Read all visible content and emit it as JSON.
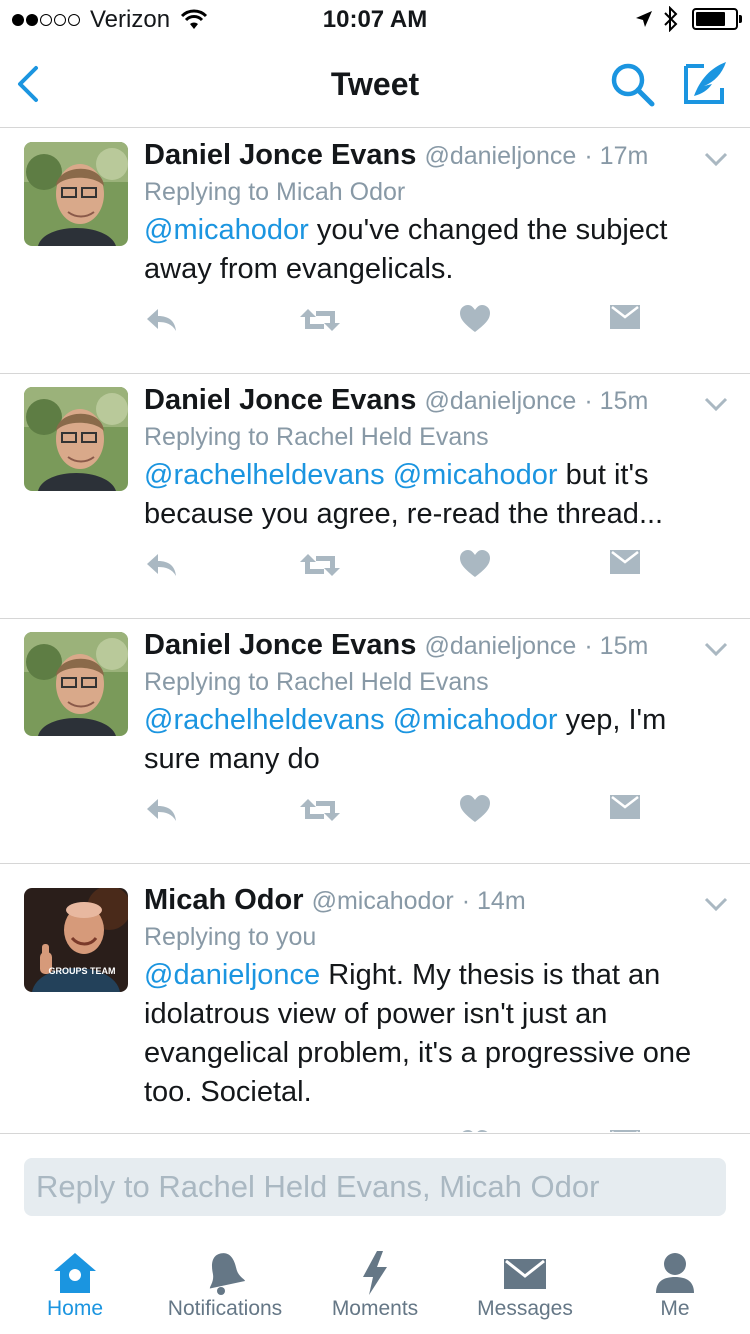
{
  "status_bar": {
    "carrier": "Verizon",
    "time": "10:07 AM",
    "signal_bars_filled": 2,
    "signal_bars_total": 5,
    "battery_level": 0.75
  },
  "nav": {
    "title": "Tweet",
    "back_icon": "chevron-left-icon",
    "search_icon": "search-icon",
    "compose_icon": "compose-icon"
  },
  "colors": {
    "accent": "#1b95e0",
    "secondary_text": "#8899a6",
    "action_icons": "#aab8c2"
  },
  "tweets": [
    {
      "name": "Daniel Jonce Evans",
      "handle": "@danieljonce",
      "time": "· 17m",
      "replying_to": "Replying to Micah Odor",
      "mentions": "@micahodor",
      "text": " you've changed the subject away from evangelicals."
    },
    {
      "name": "Daniel Jonce Evans",
      "handle": "@danieljonce",
      "time": "· 15m",
      "replying_to": "Replying to Rachel Held Evans",
      "mentions": "@rachelheldevans @micahodor",
      "text": " but it's because you agree, re-read the thread..."
    },
    {
      "name": "Daniel Jonce Evans",
      "handle": "@danieljonce",
      "time": "· 15m",
      "replying_to": "Replying to Rachel Held Evans",
      "mentions": "@rachelheldevans @micahodor",
      "text": " yep, I'm sure many do"
    },
    {
      "name": "Micah Odor",
      "handle": "@micahodor",
      "time": "· 14m",
      "replying_to": "Replying to you",
      "mentions": "@danieljonce",
      "text": " Right. My thesis is that an idolatrous view of power isn't just an evangelical problem, it's a progressive one too. Societal.",
      "avatar_shirt_text": "GROUPS TEAM"
    }
  ],
  "composer": {
    "placeholder": "Reply to Rachel Held Evans, Micah Odor"
  },
  "tabs": [
    {
      "label": "Home",
      "icon": "home-icon",
      "active": true
    },
    {
      "label": "Notifications",
      "icon": "bell-icon",
      "active": false
    },
    {
      "label": "Moments",
      "icon": "lightning-icon",
      "active": false
    },
    {
      "label": "Messages",
      "icon": "envelope-icon",
      "active": false
    },
    {
      "label": "Me",
      "icon": "person-icon",
      "active": false
    }
  ]
}
